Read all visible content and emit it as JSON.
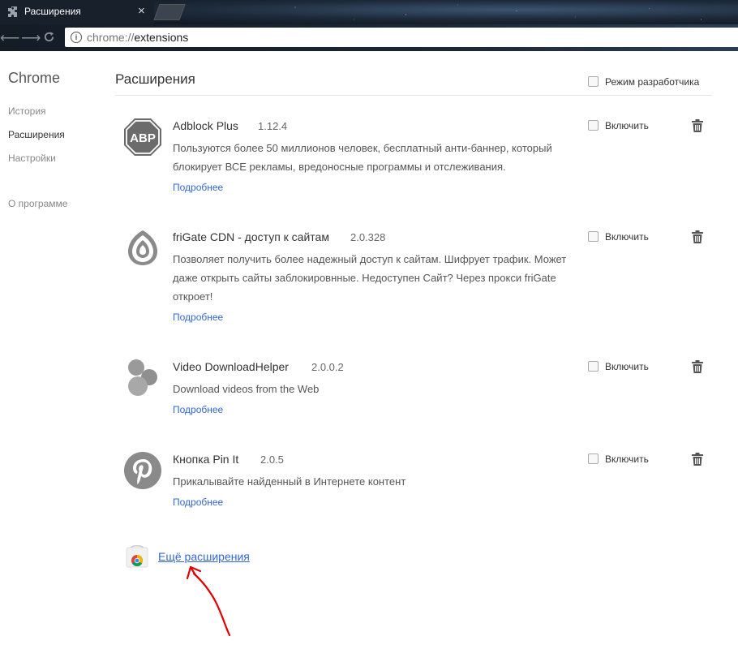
{
  "browser": {
    "tab_title": "Расширения",
    "tab_close": "×",
    "url_scheme": "chrome://",
    "url_host": "extensions"
  },
  "sidebar": {
    "brand": "Chrome",
    "items": [
      {
        "label": "История",
        "active": false
      },
      {
        "label": "Расширения",
        "active": true
      },
      {
        "label": "Настройки",
        "active": false
      },
      {
        "label": "О программе",
        "active": false
      }
    ]
  },
  "main": {
    "title": "Расширения",
    "dev_mode_label": "Режим разработчика",
    "enable_label": "Включить",
    "details_label": "Подробнее",
    "extensions": [
      {
        "name": "Adblock Plus",
        "version": "1.12.4",
        "icon": "abp-icon",
        "logo_text": "ABP",
        "description": "Пользуются более 50 миллионов человек, бесплатный анти-баннер, который блокирует ВСЕ рекламы, вредоносные программы и отслеживания."
      },
      {
        "name": "friGate CDN - доступ к сайтам",
        "version": "2.0.328",
        "icon": "frigate-icon",
        "description": "Позволяет получить более надежный доступ к сайтам. Шифрует трафик. Может даже открыть сайты заблокировнные. Недоступен Сайт? Через прокси friGate откроет!"
      },
      {
        "name": "Video DownloadHelper",
        "version": "2.0.0.2",
        "icon": "video-downloadhelper-icon",
        "description": "Download videos from the Web"
      },
      {
        "name": "Кнопка Pin It",
        "version": "2.0.5",
        "icon": "pinterest-icon",
        "description": "Прикалывайте найденный в Интернете контент"
      }
    ],
    "more_extensions_label": "Ещё расширения"
  },
  "colors": {
    "link": "#3367d6",
    "annotation_arrow": "#e00000"
  }
}
